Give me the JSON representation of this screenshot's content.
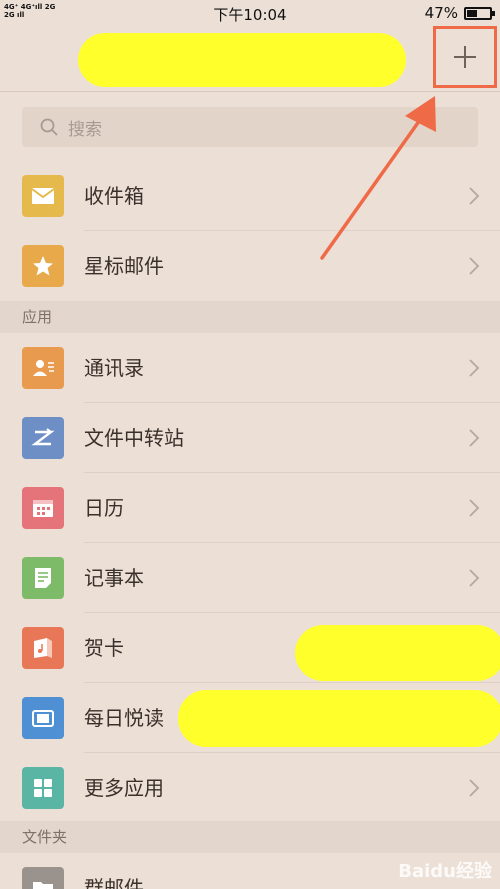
{
  "status_bar": {
    "signal_top": "4G⁺ 4G⁺ıll 2G",
    "signal_bottom": "2G ıll",
    "time": "下午10:04",
    "battery": "47%"
  },
  "header": {
    "add_label": "+"
  },
  "search": {
    "placeholder": "搜索"
  },
  "mail": {
    "items": [
      {
        "label": "收件箱",
        "icon": "envelope-icon",
        "color": "#e6b94c"
      },
      {
        "label": "星标邮件",
        "icon": "star-icon",
        "color": "#e8a94a"
      }
    ]
  },
  "apps_section": {
    "title": "应用",
    "items": [
      {
        "label": "通讯录",
        "icon": "contacts-icon",
        "color": "#e89a4e"
      },
      {
        "label": "文件中转站",
        "icon": "transfer-icon",
        "color": "#6e8fc6"
      },
      {
        "label": "日历",
        "icon": "calendar-icon",
        "color": "#e5747a"
      },
      {
        "label": "记事本",
        "icon": "notepad-icon",
        "color": "#7dbb68"
      },
      {
        "label": "贺卡",
        "icon": "greeting-card-icon",
        "color": "#e87758"
      },
      {
        "label": "每日悦读",
        "icon": "reading-icon",
        "color": "#4f8fd4"
      },
      {
        "label": "更多应用",
        "icon": "grid-icon",
        "color": "#5bb5a4"
      }
    ]
  },
  "folders_section": {
    "title": "文件夹",
    "items": [
      {
        "label": "群邮件",
        "icon": "folder-icon",
        "color": "#9a928c"
      }
    ]
  },
  "watermark": "Baidu经验",
  "colors": {
    "accent": "#ef6a47",
    "background": "#ecdfd6",
    "redaction": "#ffff2c"
  }
}
